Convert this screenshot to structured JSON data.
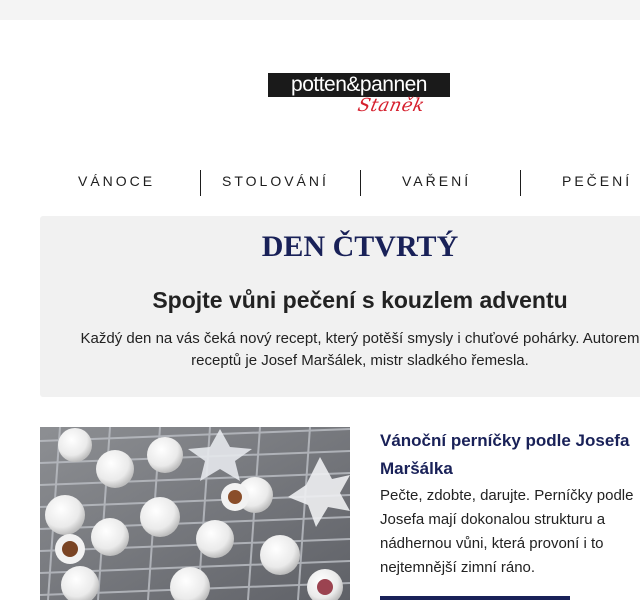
{
  "brand": {
    "name": "potten&pannen",
    "sub": "Staněk"
  },
  "nav": {
    "items": [
      {
        "label": "VÁNOCE"
      },
      {
        "label": "STOLOVÁNÍ"
      },
      {
        "label": "VAŘENÍ"
      },
      {
        "label": "PEČENÍ"
      }
    ]
  },
  "hero": {
    "day_title": "DEN ČTVRTÝ",
    "subtitle": "Spojte vůni pečení s kouzlem adventu",
    "intro": "Každý den na vás čeká nový recept, který potěší smysly i chuťové pohárky. Autorem receptů je Josef Maršálek, mistr sladkého řemesla."
  },
  "article": {
    "title": "Vánoční perníčky podle Josefa Maršálka",
    "text": "Pečte, zdobte, darujte. Perníčky podle Josefa mají dokonalou strukturu a nádhernou vůni, která provoní i to nejtemnější zimní ráno.",
    "image_alt": "Vánoční perníčky na mřížce"
  },
  "colors": {
    "accent": "#192158",
    "logo_red": "#d6202e",
    "panel_bg": "#f1f1f1"
  }
}
